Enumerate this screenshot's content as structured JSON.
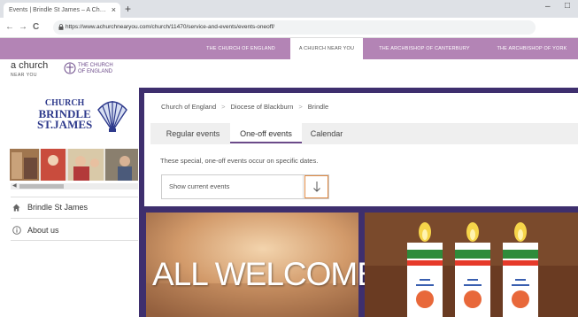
{
  "browser": {
    "tab_title": "Events | Brindle St James – A Ch…",
    "tab_close": "×",
    "new_tab": "+",
    "minimize": "–",
    "maximize": "□",
    "back": "←",
    "forward": "→",
    "reload": "C",
    "url": "https://www.achurchnearyou.com/church/11470/service-and-events/events-oneoff/"
  },
  "topnav": {
    "items": [
      {
        "label": "The Church of England"
      },
      {
        "label": "A Church Near You"
      },
      {
        "label": "The Archbishop of Canterbury"
      },
      {
        "label": "The Archbishop of York"
      }
    ]
  },
  "logos": {
    "acny_main": "a church",
    "acny_sub": "NEAR YOU",
    "coe_line1": "The Church",
    "coe_line2": "of England"
  },
  "church": {
    "name_line1": "CHURCH",
    "name_line2": "BRINDLE",
    "name_line3": "ST.JAMES"
  },
  "sidebar": {
    "items": [
      {
        "label": "Brindle St James",
        "icon": "home-icon"
      },
      {
        "label": "About us",
        "icon": "info-icon"
      }
    ]
  },
  "main": {
    "breadcrumb": [
      "Church of England",
      "Diocese of Blackburn",
      "Brindle"
    ],
    "breadcrumb_sep": ">",
    "tabs": [
      {
        "label": "Regular events",
        "active": false
      },
      {
        "label": "One-off events",
        "active": true
      },
      {
        "label": "Calendar",
        "active": false
      }
    ],
    "description": "These special, one-off events occur on specific dates.",
    "select_value": "Show current events",
    "welcome_text": "ALL WELCOME"
  },
  "colors": {
    "accent_purple": "#b384b5",
    "frame_purple": "#3e2f6e",
    "church_blue": "#2e3a8c",
    "arrow_orange": "#e08a43"
  }
}
